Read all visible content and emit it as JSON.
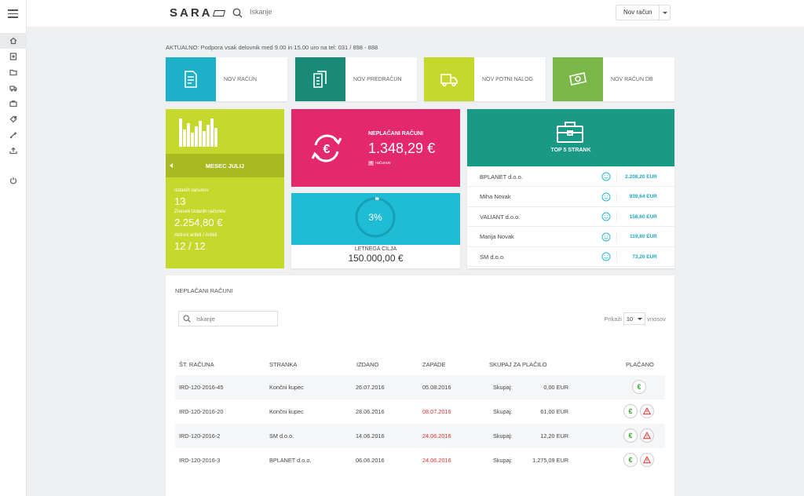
{
  "app": {
    "logo": "SARA",
    "search_placeholder": "Iskanje",
    "new_invoice_button": "Nov račun"
  },
  "notice": "AKTUALNO: Podpora vsak delovnik med 9.00 in 15.00 uro na tel: 031 / 898 - 888",
  "quick_actions": [
    {
      "label": "NOV RAČUN",
      "color": "#1fb0c9",
      "icon": "invoice-icon"
    },
    {
      "label": "NOV PREDRAČUN",
      "color": "#1a8a78",
      "icon": "documents-icon"
    },
    {
      "label": "NOV POTNI NALOG",
      "color": "#c5d82c",
      "icon": "truck-icon"
    },
    {
      "label": "NOV RAČUN DB",
      "color": "#7ab648",
      "icon": "banknote-icon"
    }
  ],
  "month_card": {
    "title": "MESEC JULIJ",
    "stats": [
      {
        "label": "Izdanih računov",
        "value": "13"
      },
      {
        "label": "Znesek izdanih računov",
        "value": "2.254,80 €"
      },
      {
        "label": "Aktivni artikli / Artikli",
        "value": "12 / 12"
      }
    ]
  },
  "unpaid_card": {
    "label": "NEPLAČANI RAČUNI",
    "amount": "1.348,29 €",
    "count": "4",
    "count_label": "računov"
  },
  "goal_card": {
    "percent": "3%",
    "progress": 0.03,
    "label": "LETNEGA CILJA",
    "value": "150.000,00 €"
  },
  "top5": {
    "title": "TOP 5 STRANK",
    "rows": [
      {
        "name": "BPLANET d.o.o.",
        "value": "2.208,20 EUR"
      },
      {
        "name": "Miha Novak",
        "value": "939,64 EUR"
      },
      {
        "name": "VALIANT d.o.o.",
        "value": "158,60 EUR"
      },
      {
        "name": "Marija Novak",
        "value": "119,80 EUR"
      },
      {
        "name": "SM d.o.o.",
        "value": "73,20 EUR"
      }
    ]
  },
  "unpaid_table": {
    "title": "NEPLAČANI RAČUNI",
    "search_placeholder": "Iskanje",
    "show_label": "Prikaži",
    "page_size": "10",
    "entries_label": "vnosov",
    "headers": {
      "number": "ŠT. RAČUNA",
      "client": "STRANKA",
      "issued": "IZDANO",
      "due": "ZAPADE",
      "total": "SKUPAJ ZA PLAČILO",
      "paid": "PLAČANO"
    },
    "total_prefix": "Skupaj:",
    "rows": [
      {
        "number": "IRD-120-2016-45",
        "client": "Končni kupec",
        "issued": "26.07.2016",
        "due": "05.08.2016",
        "overdue": false,
        "total": "0,00 EUR"
      },
      {
        "number": "IRD-120-2016-20",
        "client": "Končni kupec",
        "issued": "28.06.2016",
        "due": "08.07.2016",
        "overdue": true,
        "total": "61,00 EUR"
      },
      {
        "number": "IRD-120-2016-2",
        "client": "SM d.o.o.",
        "issued": "14.06.2016",
        "due": "24.06.2016",
        "overdue": true,
        "total": "12,20 EUR"
      },
      {
        "number": "IRD-120-2016-3",
        "client": "BPLANET d.o.o.",
        "issued": "06.06.2016",
        "due": "24.06.2016",
        "overdue": true,
        "total": "1.275,09 EUR"
      }
    ]
  }
}
